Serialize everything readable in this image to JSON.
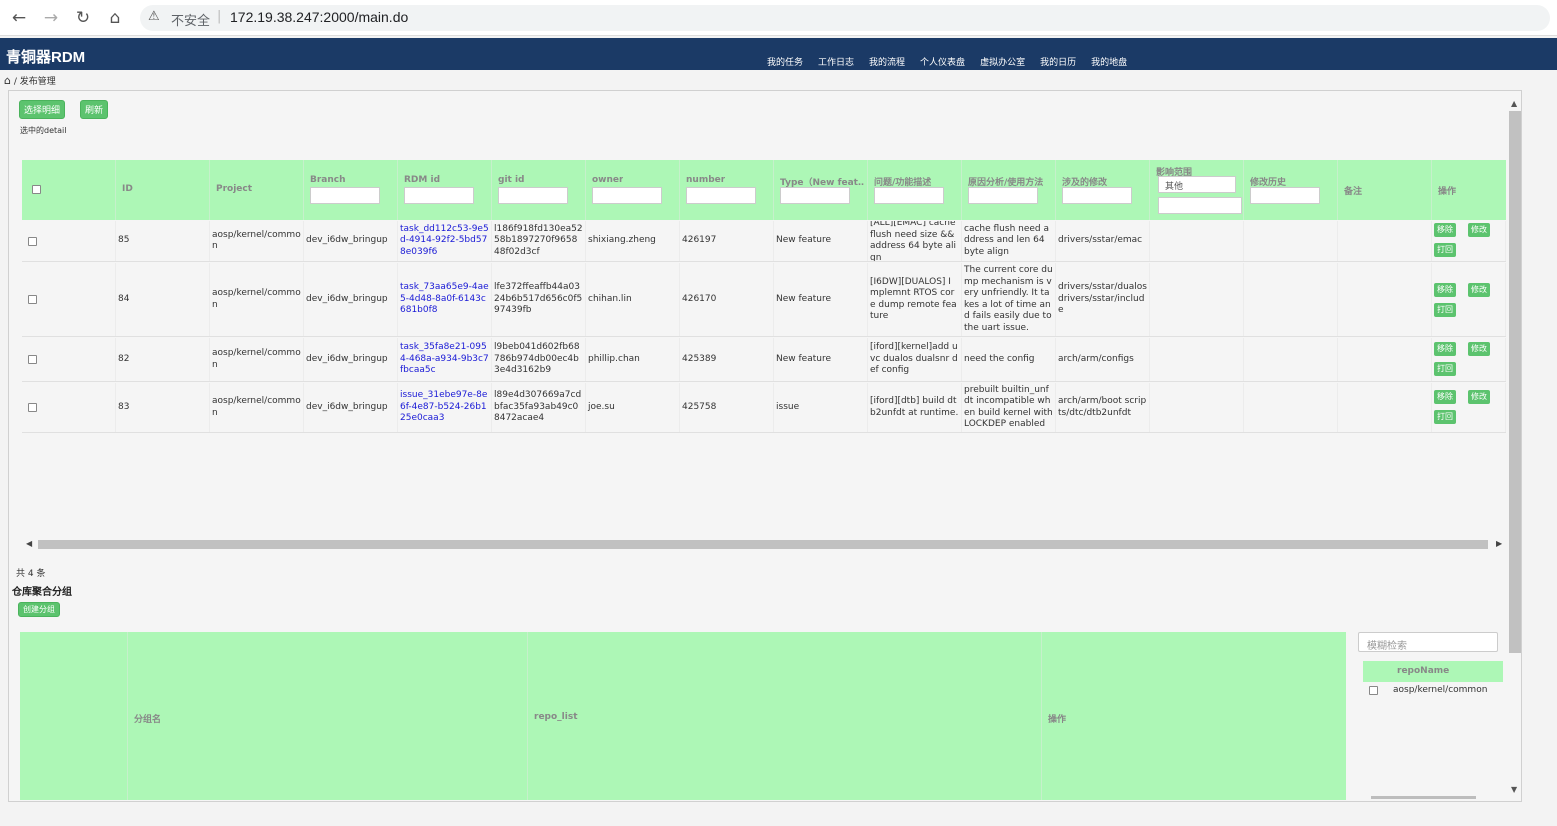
{
  "browser": {
    "insecure_label": "不安全",
    "separator": "|",
    "url": "172.19.38.247:2000/main.do"
  },
  "app": {
    "title": "青铜器RDM",
    "nav": [
      "我的任务",
      "工作日志",
      "我的流程",
      "个人仪表盘",
      "虚拟办公室",
      "我的日历",
      "我的地盘"
    ]
  },
  "breadcrumb": {
    "separator": "/",
    "current": "发布管理"
  },
  "toolbar": {
    "select_detail": "选择明细",
    "refresh": "刷新",
    "selected_label": "选中的detail"
  },
  "table1": {
    "headers": [
      "ID",
      "Project",
      "Branch",
      "RDM id",
      "git id",
      "owner",
      "number",
      "Type（New feat…",
      "问题/功能描述",
      "原因分析/使用方法",
      "涉及的修改",
      "影响范围",
      "修改历史",
      "备注",
      "操作"
    ],
    "impact_select": "其他",
    "op_labels": {
      "remove": "移除",
      "edit": "修改",
      "reject": "打回"
    },
    "rows": [
      {
        "id": "85",
        "project": "aosp/kernel/common",
        "branch": "dev_i6dw_bringup",
        "rdm": "task_dd112c53-9e5d-4914-92f2-5bd578e039f6",
        "git": "l186f918fd130ea5258b1897270f965848f02d3cf",
        "owner": "shixiang.zheng",
        "number": "426197",
        "type": "New feature",
        "desc": "[ALL][EMAC] cache flush need size && address 64 byte align",
        "reason": "cache flush need address and len 64 byte align",
        "changes": "drivers/sstar/emac"
      },
      {
        "id": "84",
        "project": "aosp/kernel/common",
        "branch": "dev_i6dw_bringup",
        "rdm": "task_73aa65e9-4ae5-4d48-8a0f-6143c681b0f8",
        "git": "lfe372ffeaffb44a0324b6b517d656c0f597439fb",
        "owner": "chihan.lin",
        "number": "426170",
        "type": "New feature",
        "desc": "[I6DW][DUALOS] Implemnt RTOS core dump remote feature",
        "reason": "The current core dump mechanism is very unfriendly. It takes a lot of time and fails easily due to the uart issue.",
        "changes": "drivers/sstar/dualos drivers/sstar/include"
      },
      {
        "id": "82",
        "project": "aosp/kernel/common",
        "branch": "dev_i6dw_bringup",
        "rdm": "task_35fa8e21-0954-468a-a934-9b3c7fbcaa5c",
        "git": "l9beb041d602fb68786b974db00ec4b3e4d3162b9",
        "owner": "phillip.chan",
        "number": "425389",
        "type": "New feature",
        "desc": "[iford][kernel]add uvc dualos dualsnr def config",
        "reason": "need the config",
        "changes": "arch/arm/configs"
      },
      {
        "id": "83",
        "project": "aosp/kernel/common",
        "branch": "dev_i6dw_bringup",
        "rdm": "issue_31ebe97e-8e6f-4e87-b524-26b125e0caa3",
        "git": "l89e4d307669a7cdbfac35fa93ab49c08472acae4",
        "owner": "joe.su",
        "number": "425758",
        "type": "issue",
        "desc": "[iford][dtb] build dtb2unfdt at runtime.",
        "reason": "prebuilt builtin_unfdt incompatible when build kernel with LOCKDEP enabled",
        "changes": "arch/arm/boot scripts/dtc/dtb2unfdt"
      }
    ]
  },
  "summary": {
    "count_label": "共 4 条",
    "section_title": "仓库聚合分组",
    "create_group": "创建分组"
  },
  "table2": {
    "headers": [
      "分组名",
      "repo_list",
      "操作"
    ]
  },
  "repo_panel": {
    "search_placeholder": "模糊检索",
    "header": "repoName",
    "items": [
      "aosp/kernel/common"
    ]
  }
}
